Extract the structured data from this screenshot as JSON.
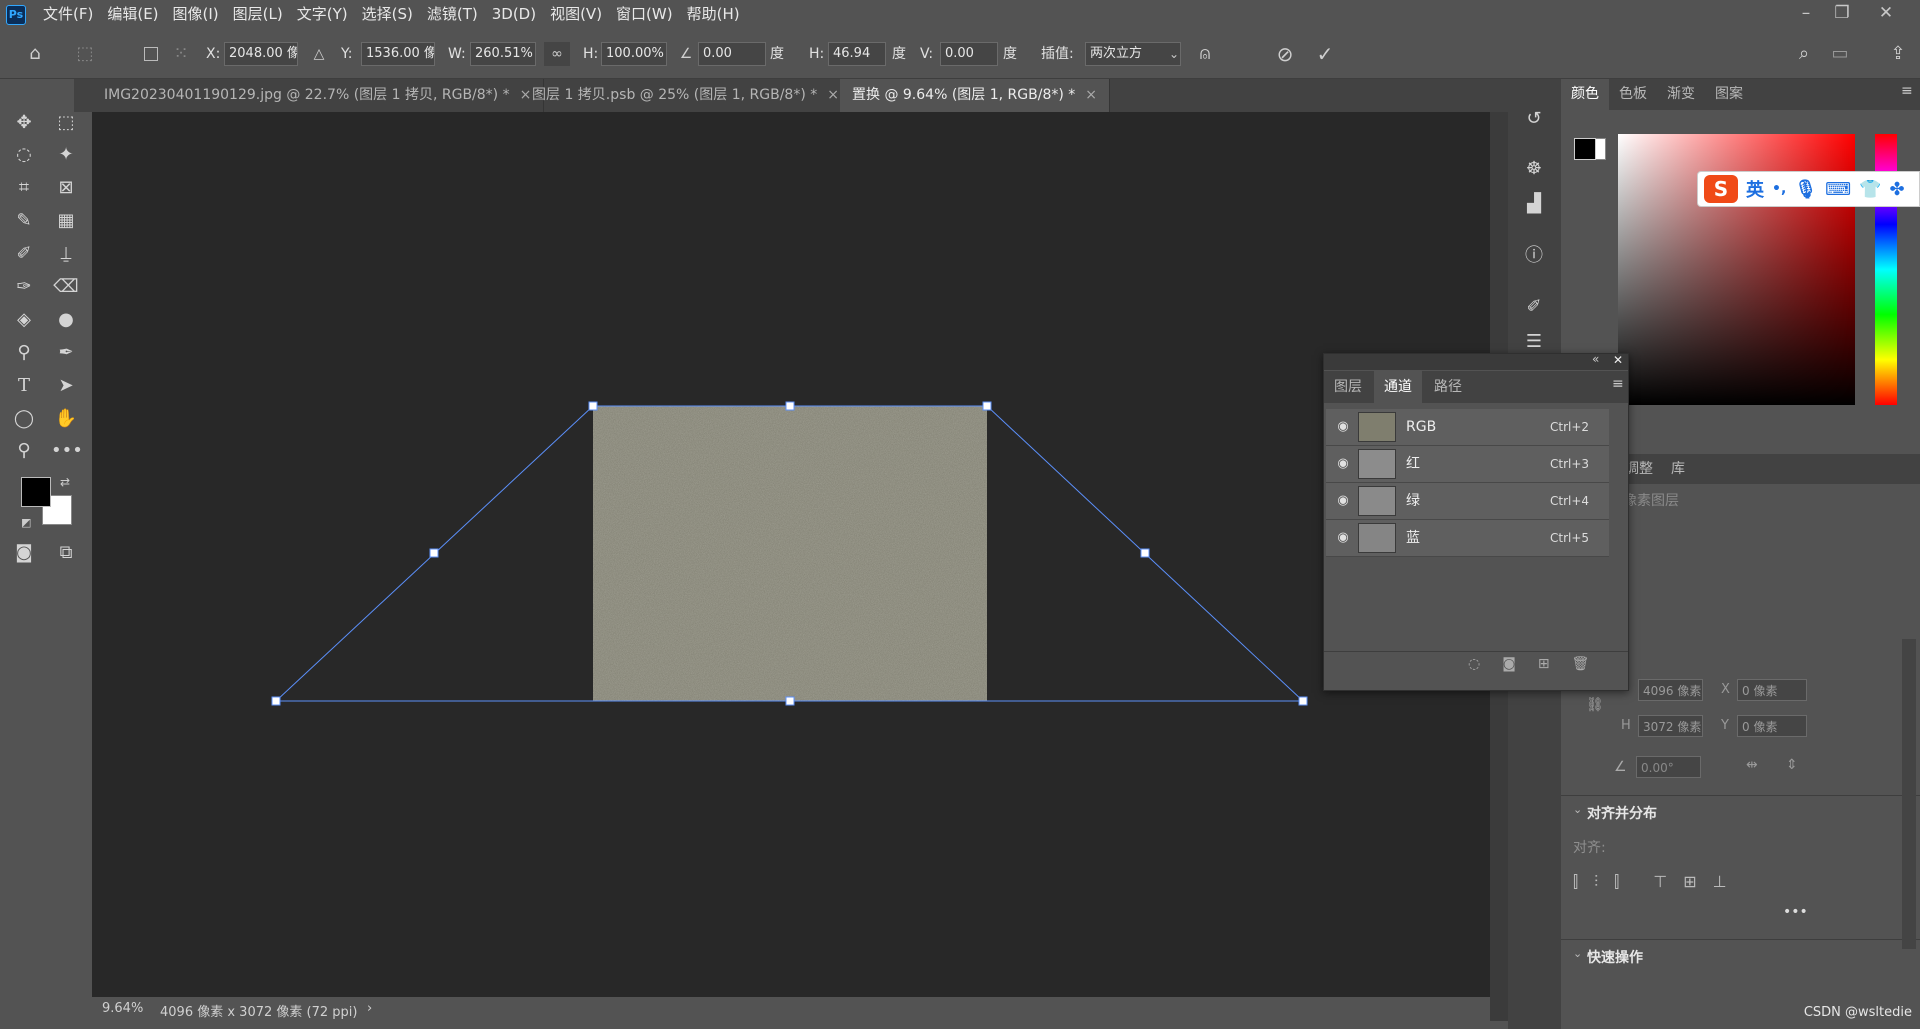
{
  "app": {
    "logo": "Ps"
  },
  "menu": [
    "文件(F)",
    "编辑(E)",
    "图像(I)",
    "图层(L)",
    "文字(Y)",
    "选择(S)",
    "滤镜(T)",
    "3D(D)",
    "视图(V)",
    "窗口(W)",
    "帮助(H)"
  ],
  "window_controls": {
    "minimize": "–",
    "restore": "❐",
    "close": "✕"
  },
  "options": {
    "x_label": "X:",
    "x_value": "2048.00 像",
    "y_label": "Y:",
    "y_value": "1536.00 像",
    "w_label": "W:",
    "w_value": "260.51%",
    "h_label": "H:",
    "h_value": "100.00%",
    "angle_value": "0.00",
    "angle_unit": "度",
    "hskew_label": "H:",
    "hskew_value": "46.94",
    "hskew_unit": "度",
    "vskew_label": "V:",
    "vskew_value": "0.00",
    "vskew_unit": "度",
    "interp_label": "插值:",
    "interp_value": "两次立方"
  },
  "tabs": [
    {
      "label": "IMG20230401190129.jpg @ 22.7% (图层 1 拷贝, RGB/8*) *",
      "active": false
    },
    {
      "label": "图层 1 拷贝.psb @ 25% (图层 1, RGB/8*) *",
      "active": false
    },
    {
      "label": "置换 @ 9.64% (图层 1, RGB/8*) *",
      "active": true
    }
  ],
  "tab_close": "×",
  "status": {
    "zoom": "9.64%",
    "doc_info": "4096 像素 x 3072 像素 (72 ppi)",
    "arrow": "›"
  },
  "color_panel": {
    "tabs": [
      "颜色",
      "色板",
      "渐变",
      "图案"
    ],
    "active": "颜色"
  },
  "props_panel": {
    "tabs": [
      "调整",
      "库"
    ],
    "title": "像素图层",
    "w_value": "4096 像素",
    "x_label": "X",
    "x_value": "0 像素",
    "h_label": "H",
    "h_value": "3072 像素",
    "y_label": "Y",
    "y_value": "0 像素",
    "angle_value": "0.00°",
    "align_section": "对齐并分布",
    "align_label": "对齐:",
    "more": "•••",
    "quick_section": "快速操作"
  },
  "channels_panel": {
    "tabs": [
      "图层",
      "通道",
      "路径"
    ],
    "active": "通道",
    "rows": [
      {
        "name": "RGB",
        "shortcut": "Ctrl+2"
      },
      {
        "name": "红",
        "shortcut": "Ctrl+3"
      },
      {
        "name": "绿",
        "shortcut": "Ctrl+4"
      },
      {
        "name": "蓝",
        "shortcut": "Ctrl+5"
      }
    ]
  },
  "ime": {
    "label": "英",
    "punct": "•,"
  },
  "watermark": "CSDN @wsltedie",
  "colors": {
    "accent": "#31a8ff",
    "canvas": "#282828",
    "ui": "#535353",
    "transform": "#5b8ff9"
  }
}
